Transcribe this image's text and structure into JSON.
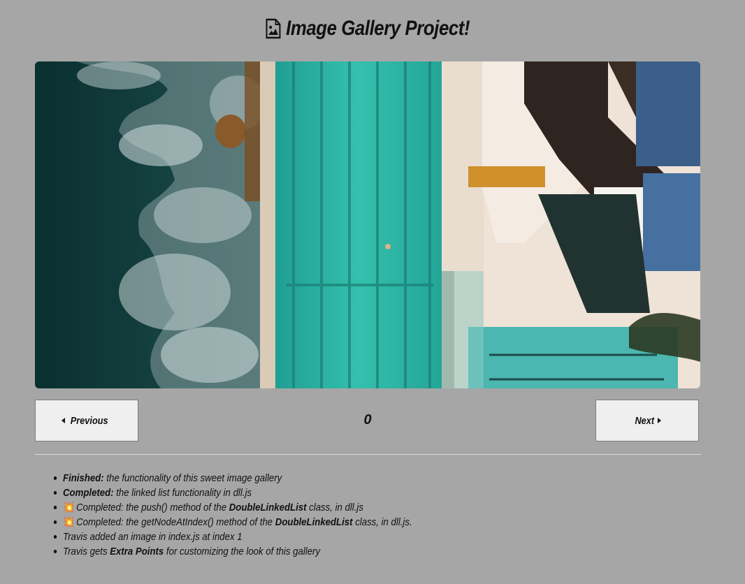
{
  "header": {
    "title": "Image Gallery Project!",
    "icon": "image-file-icon"
  },
  "gallery": {
    "image_alt": "aerial view of ocean pool beside rocks and building",
    "current_index": "0"
  },
  "controls": {
    "prev_label": "Previous",
    "next_label": "Next"
  },
  "notes": [
    {
      "strong": "Finished:",
      "rest": " the functionality of this sweet image gallery"
    },
    {
      "strong": "Completed:",
      "rest": " the linked list functionality in ",
      "em": "dll.js"
    },
    {
      "icon": "💥",
      "pre": "Completed: the push() method of the ",
      "strong": "DoubleLinkedList",
      "rest": " class, in dll.js"
    },
    {
      "icon": "💥",
      "pre": "Completed: the getNodeAtIndex() method of the ",
      "strong": "DoubleLinkedList",
      "rest": " class, in dll.js."
    },
    {
      "pre": "Travis added an image in ",
      "em": "index.js",
      "rest": " at index 1"
    },
    {
      "pre": "Travis gets ",
      "strong": "Extra Points",
      "rest": " for customizing the look of this ",
      "em": "gallery"
    }
  ],
  "colors": {
    "background": "#a6a6a6",
    "button_bg": "#efefef",
    "pool": "#2fb5a4",
    "ocean": "#0e3a38"
  }
}
